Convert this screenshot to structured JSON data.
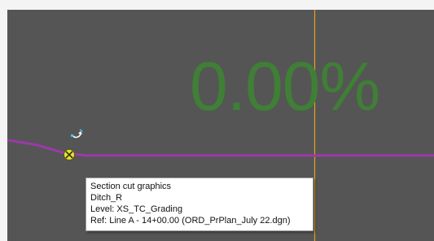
{
  "view": {
    "overlay_value": "0.00%",
    "colors": {
      "background": "#555555",
      "grid_dots": "#c8c8c8",
      "vertical_line": "#e6a020",
      "profile_line": "#9b3aa8",
      "overlay_text": "#3f7f36",
      "tooltip_bg": "#ffffff"
    }
  },
  "tooltip": {
    "title": "Section cut graphics",
    "element": "Ditch_R",
    "level": "Level: XS_TC_Grading",
    "reference": "Ref: Line A - 14+00.00 (ORD_PrPlan_July 22.dgn)"
  },
  "icons": {
    "cursor": "rotate-cursor-icon",
    "snap": "keypoint-snap-icon"
  }
}
